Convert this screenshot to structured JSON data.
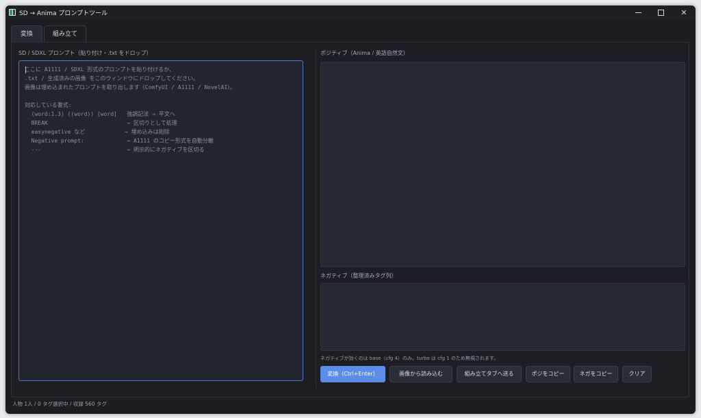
{
  "window": {
    "title": "SD → Anima プロンプトツール"
  },
  "tabs": [
    {
      "label": "変換"
    },
    {
      "label": "組み立て"
    }
  ],
  "left": {
    "label": "SD / SDXL プロンプト（貼り付け・.txt をドロップ）",
    "placeholder": "ここに A1111 / SDXL 形式のプロンプトを貼り付けるか、\n.txt / 生成済みの画像 をこのウィンドウにドロップしてください。\n画像は埋め込まれたプロンプトを取り出します（ComfyUI / A1111 / NovelAI）。\n\n対応している書式:\n  (word:1.3) ((word)) [word]   強調記法 → 平文へ\n  BREAK                        → 区切りとして処理\n  easynegative など            → 埋め込みは削除\n  Negative prompt:             → A1111 のコピー形式を自動分離\n  ---                          → 明示的にネガティブを区切る"
  },
  "right": {
    "positive_label": "ポジティブ（Anima / 英語自然文）",
    "negative_label": "ネガティブ（整理済みタグ列）",
    "note": "ネガティブが効くのは base（cfg 4）のみ。turbo は cfg 1 のため無視されます。"
  },
  "buttons": {
    "convert": "変換（Ctrl+Enter）",
    "load_image": "画像から読み込む",
    "send_assemble": "組み立てタブへ送る",
    "copy_positive": "ポジをコピー",
    "copy_negative": "ネガをコピー",
    "clear": "クリア"
  },
  "status": "人物 1人 / 0 タグ選択中 / 収録 560 タグ",
  "colors": {
    "accent": "#5b8de6",
    "background": "#1b1d23"
  }
}
